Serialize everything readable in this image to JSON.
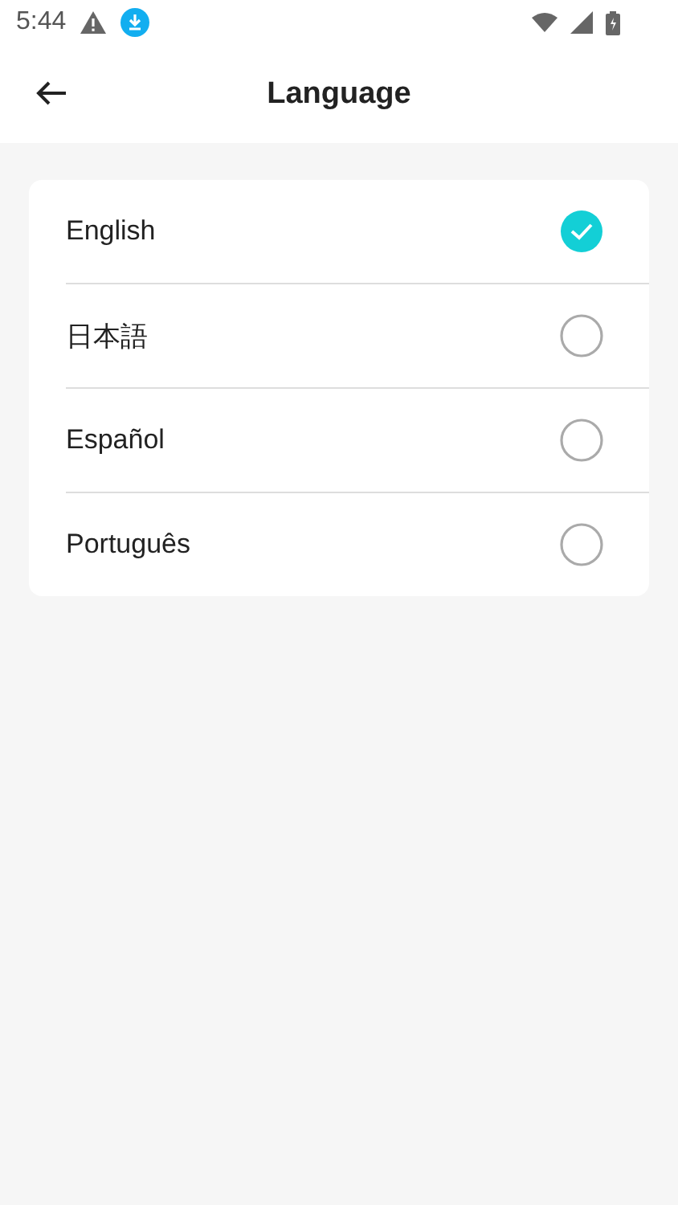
{
  "status_bar": {
    "time": "5:44"
  },
  "header": {
    "title": "Language"
  },
  "languages": [
    {
      "label": "English",
      "selected": true
    },
    {
      "label": "日本語",
      "selected": false
    },
    {
      "label": "Español",
      "selected": false
    },
    {
      "label": "Português",
      "selected": false
    }
  ]
}
